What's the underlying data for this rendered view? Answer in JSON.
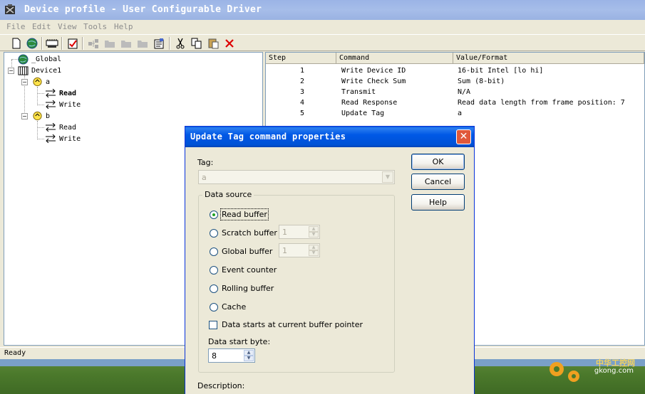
{
  "window": {
    "title": "Device profile - User Configurable Driver"
  },
  "menu": [
    "File",
    "Edit",
    "View",
    "Tools",
    "Help"
  ],
  "tree": {
    "global": "_Global",
    "device": "Device1",
    "tag_a": "a",
    "tag_a_read": "Read",
    "tag_a_write": "Write",
    "tag_b": "b",
    "tag_b_read": "Read",
    "tag_b_write": "Write"
  },
  "list": {
    "columns": [
      "Step",
      "Command",
      "Value/Format"
    ],
    "rows": [
      {
        "step": "1",
        "command": "Write Device ID",
        "value": "16-bit Intel  [lo hi]"
      },
      {
        "step": "2",
        "command": "Write Check Sum",
        "value": "Sum (8-bit)"
      },
      {
        "step": "3",
        "command": "Transmit",
        "value": "N/A"
      },
      {
        "step": "4",
        "command": "Read Response",
        "value": "Read data length from frame position: 7"
      },
      {
        "step": "5",
        "command": "Update Tag",
        "value": "a"
      }
    ]
  },
  "status": "Ready",
  "dialog": {
    "title": "Update Tag command properties",
    "tag_label": "Tag:",
    "tag_value": "a",
    "buttons": {
      "ok": "OK",
      "cancel": "Cancel",
      "help": "Help"
    },
    "group_label": "Data source",
    "options": {
      "read_buffer": "Read buffer",
      "scratch_buffer": "Scratch buffer",
      "global_buffer": "Global buffer",
      "event_counter": "Event counter",
      "rolling_buffer": "Rolling buffer",
      "cache": "Cache"
    },
    "selected_option": "read_buffer",
    "scratch_value": "1",
    "global_value": "1",
    "checkbox_label": "Data starts at current buffer pointer",
    "checkbox_checked": false,
    "start_byte_label": "Data start byte:",
    "start_byte_value": "8",
    "description_label": "Description:"
  },
  "watermark": {
    "text": "中华工控网",
    "sub": "gkong.com"
  }
}
